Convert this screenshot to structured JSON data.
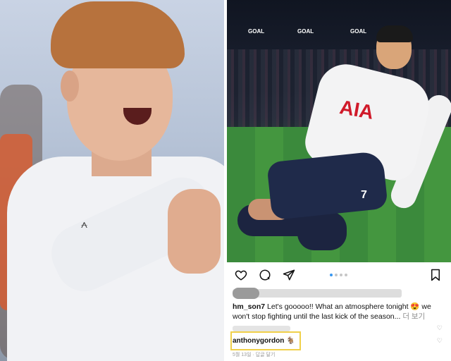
{
  "post": {
    "username": "hm_son7",
    "caption": "Let's gooooo!! What an atmosphere tonight 😍 we won't stop fighting until the last kick of the season...",
    "more_label": "더 보기",
    "comment_user": "anthonygordon",
    "comment_emoji": "🐐",
    "comment_meta": "5월 13일 · 답글 달기",
    "carousel_dots": 4,
    "carousel_active_index": 0
  },
  "photo_right": {
    "shirt_sponsor": "AIA",
    "shirt_number": "7",
    "banner_text": "GOAL"
  },
  "icons": {
    "like": "heart-icon",
    "comment": "comment-icon",
    "share": "send-icon",
    "save": "bookmark-icon"
  },
  "colors": {
    "highlight_border": "#f0d04a",
    "carousel_active": "#3897f0",
    "sponsor_red": "#d01a2a"
  }
}
